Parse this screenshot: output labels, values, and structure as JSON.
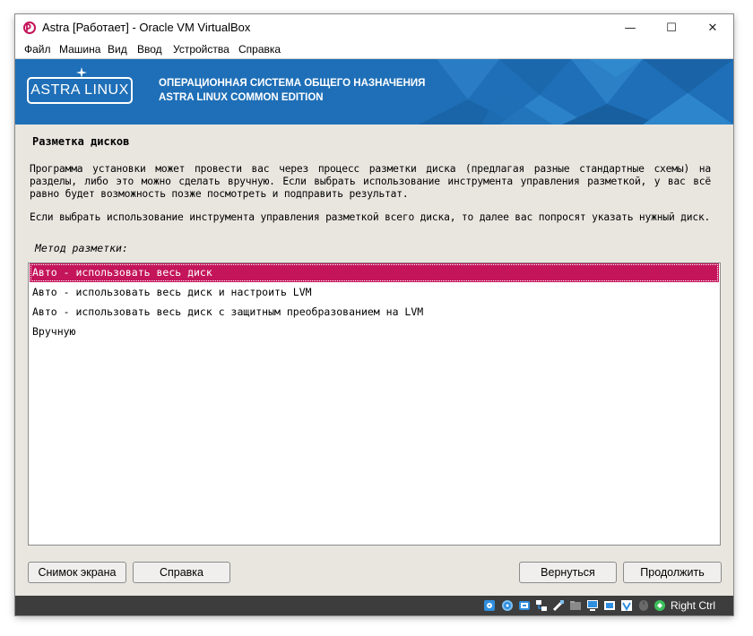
{
  "window": {
    "title": "Astra [Работает] - Oracle VM VirtualBox",
    "controls": {
      "minimize": "—",
      "maximize": "☐",
      "close": "✕"
    }
  },
  "menu": {
    "items": [
      "Файл",
      "Машина",
      "Вид",
      "Ввод",
      "Устройства",
      "Справка"
    ]
  },
  "banner": {
    "logo_text": "ASTRA LINUX",
    "line1": "ОПЕРАЦИОННАЯ СИСТЕМА ОБЩЕГО НАЗНАЧЕНИЯ",
    "line2": "ASTRA LINUX COMMON EDITION"
  },
  "content": {
    "title": "Разметка дисков",
    "paragraph1": "Программа установки может провести вас через процесс разметки диска (предлагая разные стандартные схемы) на разделы, либо это можно сделать вручную. Если выбрать использование инструмента управления разметкой, у вас всё равно будет возможность позже посмотреть и подправить результат.",
    "paragraph2": "Если выбрать использование инструмента управления разметкой всего диска, то далее вас попросят указать нужный диск.",
    "method_label": "Метод разметки:",
    "options": [
      "Авто - использовать весь диск",
      "Авто - использовать весь диск и настроить LVM",
      "Авто - использовать весь диск с защитным преобразованием на LVM",
      "Вручную"
    ],
    "selected_index": 0
  },
  "buttons": {
    "screenshot": "Снимок экрана",
    "help": "Справка",
    "back": "Вернуться",
    "continue": "Продолжить"
  },
  "statusbar": {
    "icons": [
      "hard-disk-icon",
      "optical-disk-icon",
      "audio-icon",
      "network-icon",
      "usb-icon",
      "shared-folders-icon",
      "display-icon",
      "video-capture-icon",
      "mouse-integration-icon",
      "recording-icon",
      "keyboard-capture-icon"
    ],
    "host_key": "Right Ctrl"
  },
  "colors": {
    "banner_blue": "#1e6fb7",
    "selection": "#c4145a",
    "background": "#e9e6e0",
    "statusbar": "#3d3d3d"
  }
}
